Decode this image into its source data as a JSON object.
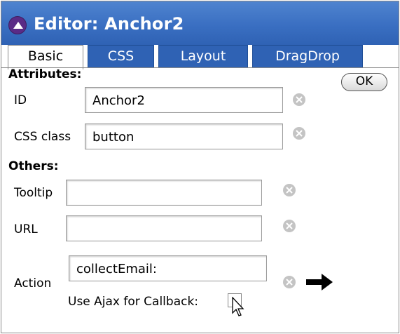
{
  "window": {
    "title": "Editor: Anchor2"
  },
  "tabs": [
    {
      "label": "Basic",
      "active": true
    },
    {
      "label": "CSS",
      "active": false
    },
    {
      "label": "Layout",
      "active": false
    },
    {
      "label": "DragDrop",
      "active": false
    }
  ],
  "ok_label": "OK",
  "attributes": {
    "heading": "Attributes:",
    "id": {
      "label": "ID",
      "value": "Anchor2"
    },
    "css_class": {
      "label": "CSS class",
      "value": "button"
    }
  },
  "others": {
    "heading": "Others:",
    "tooltip": {
      "label": "Tooltip",
      "value": ""
    },
    "url": {
      "label": "URL",
      "value": ""
    },
    "action": {
      "label": "Action",
      "value": "collectEmail:"
    },
    "use_ajax": {
      "label": "Use Ajax for Callback:",
      "checked": false
    }
  },
  "colors": {
    "titlebar": "#3a6fc2",
    "tab": "#2f62b4",
    "collapse_button": "#5a2b86"
  },
  "icons": [
    "collapse-icon",
    "clear-icon",
    "arrow-right-icon",
    "mouse-cursor-icon"
  ]
}
